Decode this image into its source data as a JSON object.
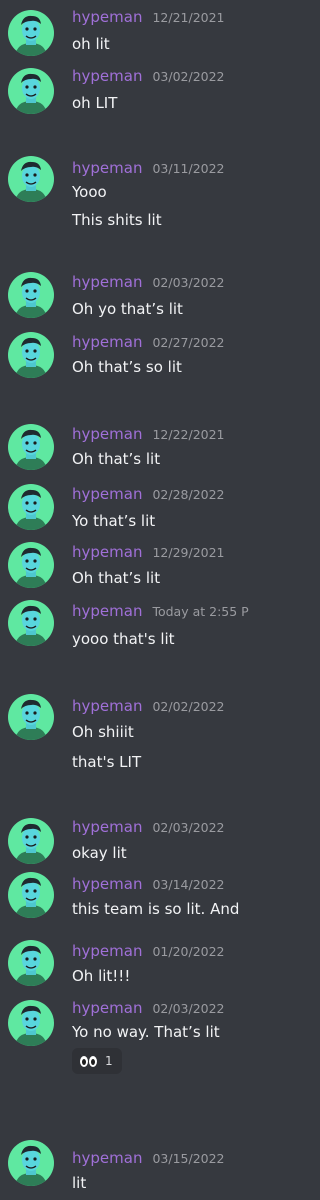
{
  "theme": {
    "background": "#36393f",
    "username_color": "#a070d8",
    "avatar_color": "#5fe8a1"
  },
  "username": "hypeman",
  "messages": [
    {
      "timestamp": "12/21/2021",
      "lines": [
        "oh lit"
      ]
    },
    {
      "timestamp": "03/02/2022",
      "lines": [
        "oh LIT"
      ]
    },
    {
      "timestamp": "03/11/2022",
      "lines": [
        "Yooo",
        "This shits lit"
      ]
    },
    {
      "timestamp": "02/03/2022",
      "lines": [
        "Oh yo that’s lit"
      ]
    },
    {
      "timestamp": "02/27/2022",
      "lines": [
        "Oh that’s so lit"
      ]
    },
    {
      "timestamp": "12/22/2021",
      "lines": [
        "Oh that’s lit"
      ]
    },
    {
      "timestamp": "02/28/2022",
      "lines": [
        "Yo that’s lit"
      ]
    },
    {
      "timestamp": "12/29/2021",
      "lines": [
        "Oh that’s lit"
      ]
    },
    {
      "timestamp": "Today at 2:55 P",
      "lines": [
        "yooo that's lit"
      ]
    },
    {
      "timestamp": "02/02/2022",
      "lines": [
        "Oh shiiit",
        "that's LIT"
      ]
    },
    {
      "timestamp": "02/03/2022",
      "lines": [
        "okay lit"
      ]
    },
    {
      "timestamp": "03/14/2022",
      "lines": [
        "this team is so lit. And"
      ]
    },
    {
      "timestamp": "01/20/2022",
      "lines": [
        "Oh lit!!!"
      ]
    },
    {
      "timestamp": "02/03/2022",
      "lines": [
        "Yo no way. That’s lit"
      ],
      "reaction": {
        "icon": "eyes-emoji-icon",
        "count": "1"
      }
    },
    {
      "timestamp": "03/15/2022",
      "lines": [
        "lit"
      ]
    }
  ]
}
